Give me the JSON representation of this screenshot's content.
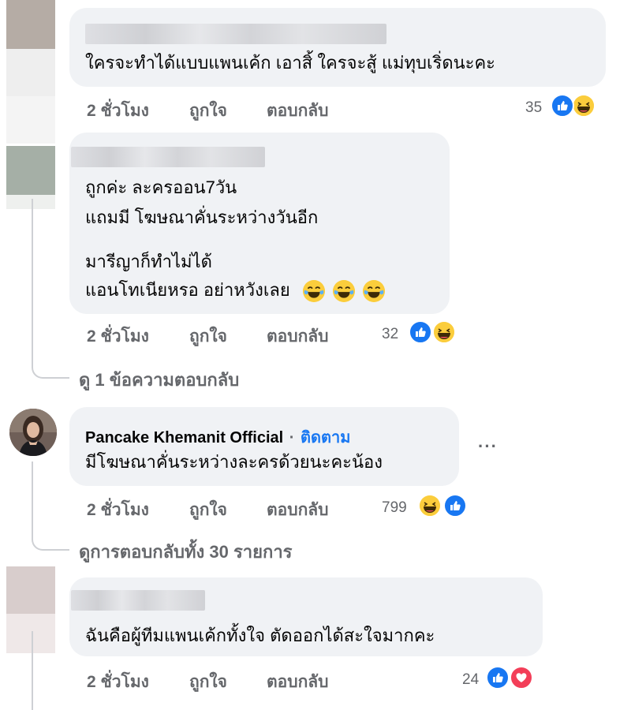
{
  "comments": [
    {
      "text_lines": [
        "ใครจะทำได้แบบแพนเค้ก เอาสิ้ ใครจะสู้ แม่ทุบเริ่ดนะคะ"
      ],
      "time": "2 ชั่วโมง",
      "like_label": "ถูกใจ",
      "reply_label": "ตอบกลับ",
      "reaction_count": "35",
      "reactions": [
        "like-icon",
        "haha-icon"
      ]
    },
    {
      "text_lines": [
        "ถูกค่ะ ละครออน7วัน",
        "แถมมี โฆษณาคั่นระหว่างวันอีก",
        "มารีญาก็ทำไม่ได้",
        "แอนโทเนียหรอ อย่าหวังเลย"
      ],
      "time": "2 ชั่วโมง",
      "like_label": "ถูกใจ",
      "reply_label": "ตอบกลับ",
      "reaction_count": "32",
      "reactions": [
        "like-icon",
        "haha-icon"
      ],
      "view_replies": "ดู 1 ข้อความตอบกลับ"
    },
    {
      "author": "Pancake Khemanit Official",
      "separator": "·",
      "follow_label": "ติดตาม",
      "text_lines": [
        "มีโฆษณาคั่นระหว่างละครด้วยนะคะน้อง"
      ],
      "more_label": "···",
      "time": "2 ชั่วโมง",
      "like_label": "ถูกใจ",
      "reply_label": "ตอบกลับ",
      "reaction_count": "799",
      "reactions": [
        "haha-icon",
        "like-icon"
      ],
      "view_replies": "ดูการตอบกลับทั้ง 30 รายการ"
    },
    {
      "text_lines": [
        "ฉันคือผู้ทีมแพนเค้กทั้งใจ ตัดออกได้สะใจมากคะ"
      ],
      "time": "2 ชั่วโมง",
      "like_label": "ถูกใจ",
      "reply_label": "ตอบกลับ",
      "reaction_count": "24",
      "reactions": [
        "like-icon",
        "love-icon"
      ]
    }
  ],
  "colors": {
    "bubble": "#f0f2f5",
    "meta_text": "#65676b",
    "link_blue": "#1877f2",
    "like_blue": "#1877f2",
    "haha_yellow": "#fbcd3c",
    "love_red": "#f33e58"
  }
}
